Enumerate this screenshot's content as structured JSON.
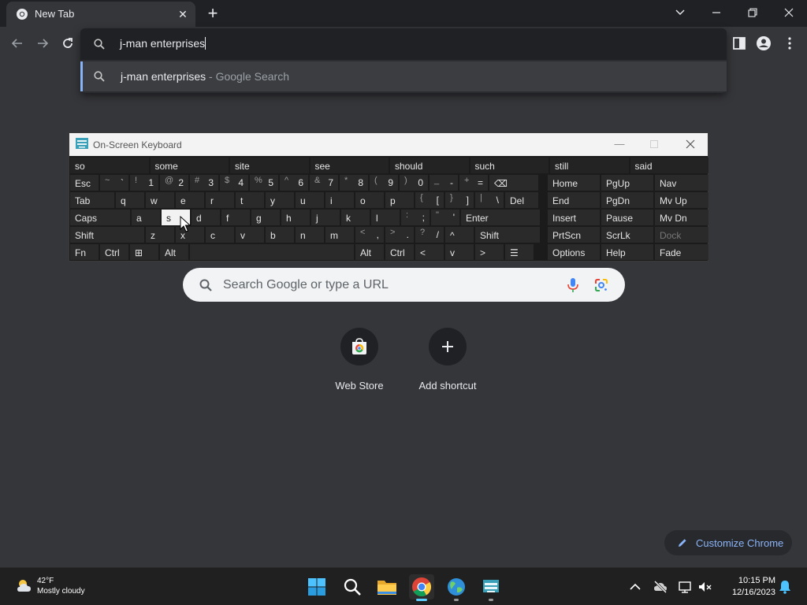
{
  "browser": {
    "tab": {
      "title": "New Tab"
    },
    "omnibox": {
      "input_value": "j-man enterprises",
      "suggestion": {
        "query": "j-man enterprises",
        "suffix": " - Google Search"
      }
    }
  },
  "osk": {
    "title": "On-Screen Keyboard",
    "predictions": [
      "so",
      "some",
      "site",
      "see",
      "should",
      "such",
      "still",
      "said"
    ],
    "row1": [
      {
        "l": "Esc"
      },
      {
        "u": "~",
        "d": "`"
      },
      {
        "u": "!",
        "d": "1"
      },
      {
        "u": "@",
        "d": "2"
      },
      {
        "u": "#",
        "d": "3"
      },
      {
        "u": "$",
        "d": "4"
      },
      {
        "u": "%",
        "d": "5"
      },
      {
        "u": "^",
        "d": "6"
      },
      {
        "u": "&",
        "d": "7"
      },
      {
        "u": "*",
        "d": "8"
      },
      {
        "u": "(",
        "d": "9"
      },
      {
        "u": ")",
        "d": "0"
      },
      {
        "u": "_",
        "d": "-"
      },
      {
        "u": "+",
        "d": "="
      },
      {
        "l": "⌫"
      }
    ],
    "row2": [
      {
        "l": "Tab"
      },
      {
        "l": "q"
      },
      {
        "l": "w"
      },
      {
        "l": "e"
      },
      {
        "l": "r"
      },
      {
        "l": "t"
      },
      {
        "l": "y"
      },
      {
        "l": "u"
      },
      {
        "l": "i"
      },
      {
        "l": "o"
      },
      {
        "l": "p"
      },
      {
        "u": "{",
        "d": "["
      },
      {
        "u": "}",
        "d": "]"
      },
      {
        "u": "|",
        "d": "\\"
      },
      {
        "l": "Del"
      }
    ],
    "row3": [
      {
        "l": "Caps"
      },
      {
        "l": "a"
      },
      {
        "l": "s"
      },
      {
        "l": "d"
      },
      {
        "l": "f"
      },
      {
        "l": "g"
      },
      {
        "l": "h"
      },
      {
        "l": "j"
      },
      {
        "l": "k"
      },
      {
        "l": "l"
      },
      {
        "u": ":",
        "d": ";"
      },
      {
        "u": "\"",
        "d": "'"
      },
      {
        "l": "Enter"
      }
    ],
    "row4": [
      {
        "l": "Shift"
      },
      {
        "l": "z"
      },
      {
        "l": "x"
      },
      {
        "l": "c"
      },
      {
        "l": "v"
      },
      {
        "l": "b"
      },
      {
        "l": "n"
      },
      {
        "l": "m"
      },
      {
        "u": "<",
        "d": ","
      },
      {
        "u": ">",
        "d": "."
      },
      {
        "u": "?",
        "d": "/"
      },
      {
        "l": "^"
      },
      {
        "l": "Shift"
      }
    ],
    "row5": [
      {
        "l": "Fn"
      },
      {
        "l": "Ctrl"
      },
      {
        "l": "⊞"
      },
      {
        "l": "Alt"
      },
      {
        "l": ""
      },
      {
        "l": "Alt"
      },
      {
        "l": "Ctrl"
      },
      {
        "l": "<"
      },
      {
        "l": "v"
      },
      {
        "l": ">"
      },
      {
        "l": "☰"
      }
    ],
    "nav": [
      [
        "Home",
        "PgUp",
        "Nav"
      ],
      [
        "End",
        "PgDn",
        "Mv Up"
      ],
      [
        "Insert",
        "Pause",
        "Mv Dn"
      ],
      [
        "PrtScn",
        "ScrLk",
        "Dock"
      ],
      [
        "Options",
        "Help",
        "Fade"
      ]
    ],
    "pressed_key": "s"
  },
  "ntp": {
    "search_placeholder": "Search Google or type a URL",
    "shortcuts": [
      {
        "label": "Web Store",
        "icon": "web-store-icon"
      },
      {
        "label": "Add shortcut",
        "icon": "plus-icon"
      }
    ],
    "customize_label": "Customize Chrome"
  },
  "taskbar": {
    "weather": {
      "temp": "42°F",
      "desc": "Mostly cloudy"
    },
    "clock": {
      "time": "10:15 PM",
      "date": "12/16/2023"
    }
  },
  "colors": {
    "accent": "#8ab4f8",
    "page_bg": "#35363a",
    "tabstrip_bg": "#202124",
    "taskbar_accent": "#60cdff"
  }
}
